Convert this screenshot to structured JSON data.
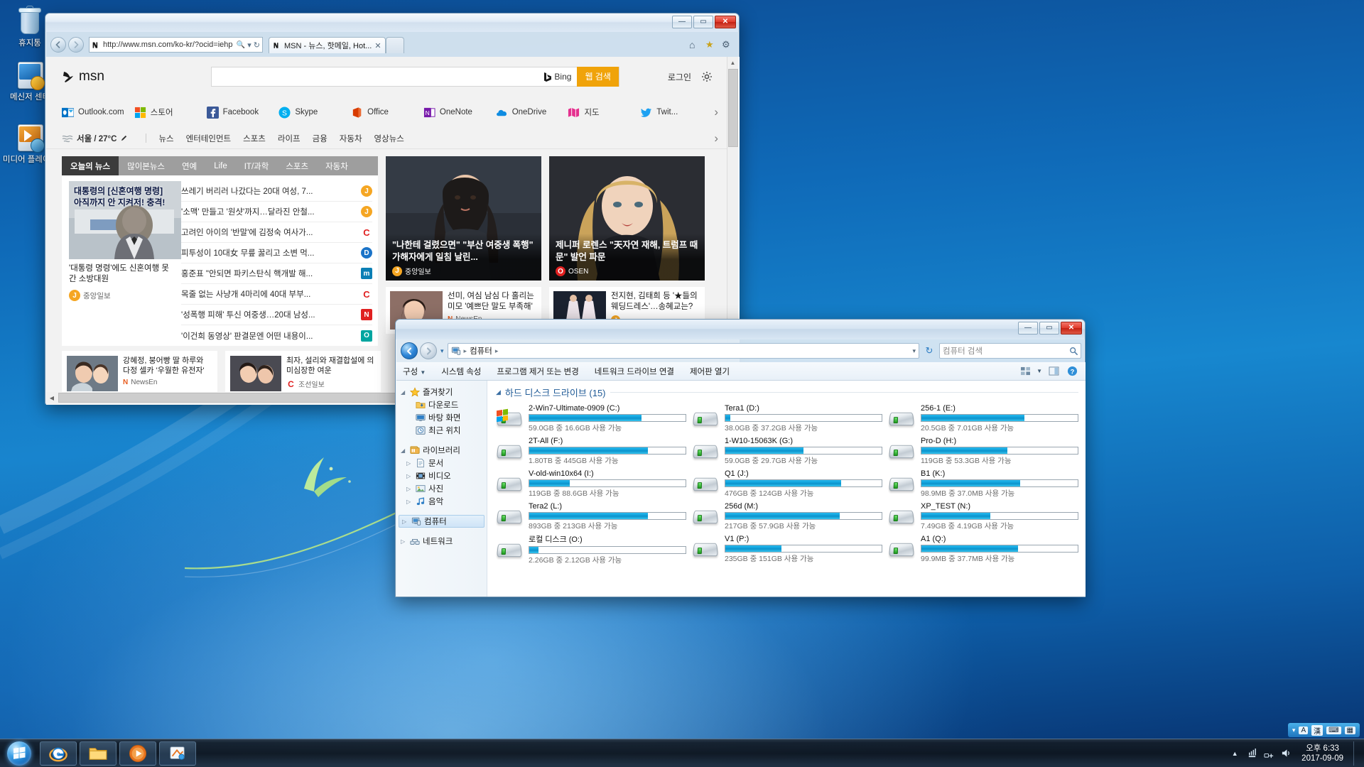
{
  "desktop": {
    "icons": [
      {
        "name": "recycle-bin",
        "label": "휴지통"
      },
      {
        "name": "messenger-center",
        "label": "메신저 센터"
      },
      {
        "name": "media-player",
        "label": "미디어 플레이..."
      }
    ]
  },
  "ie": {
    "window_title": "MSN - 뉴스, 핫메일, Hot...",
    "address": "http://www.msn.com/ko-kr/?ocid=iehp",
    "tabs": [
      {
        "label": "MSN - 뉴스, 핫메일, Hot...",
        "close": "✕"
      }
    ],
    "newtab_label": "",
    "buttons": {
      "back": "◀",
      "forward": "▶",
      "search": "🔍",
      "dropdown": "▾",
      "refresh": "↻",
      "home": "⌂",
      "favorites": "★",
      "tools": "⚙"
    },
    "win_controls": {
      "minimize": "—",
      "maximize": "▭",
      "close": "✕"
    }
  },
  "msn": {
    "logo": "msn",
    "search_placeholder": "",
    "search_value": "",
    "bing_label": "Bing",
    "web_search_label": "웹 검색",
    "signin_label": "로그인",
    "settings_icon": "gear-icon",
    "apps": [
      {
        "label": "Outlook.com",
        "icon": "outlook-icon"
      },
      {
        "label": "스토어",
        "icon": "store-icon"
      },
      {
        "label": "Facebook",
        "icon": "facebook-icon"
      },
      {
        "label": "Skype",
        "icon": "skype-icon"
      },
      {
        "label": "Office",
        "icon": "office-icon"
      },
      {
        "label": "OneNote",
        "icon": "onenote-icon"
      },
      {
        "label": "OneDrive",
        "icon": "onedrive-icon"
      },
      {
        "label": "지도",
        "icon": "maps-icon"
      },
      {
        "label": "Twit...",
        "icon": "twitter-icon"
      }
    ],
    "apps_next": "›",
    "weather": "서울 / 27°C",
    "weather_edit_icon": "pencil-icon",
    "subnav": [
      "뉴스",
      "엔터테인먼트",
      "스포츠",
      "라이프",
      "금융",
      "자동차",
      "영상뉴스"
    ],
    "subnav_next": "›",
    "news_tabs": [
      {
        "label": "오늘의 뉴스",
        "active": true
      },
      {
        "label": "많이본뉴스",
        "active": false
      },
      {
        "label": "연예",
        "active": false
      },
      {
        "label": "Life",
        "active": false
      },
      {
        "label": "IT/과학",
        "active": false
      },
      {
        "label": "스포츠",
        "active": false
      },
      {
        "label": "자동차",
        "active": false
      }
    ],
    "lead": {
      "overlay_line1": "대통령의 [신혼여행 명령]",
      "overlay_line2": "아직까지 안 지켜저! 충격!",
      "title": "'대통령 명령'에도 신혼여행 못 간 소방대원",
      "source": "중앙일보"
    },
    "headlines": [
      {
        "text": "쓰레기 버리러 나갔다는 20대 여성, 7...",
        "chip": "J",
        "chip_color": "#f5a623"
      },
      {
        "text": "'소맥' 만들고 '원샷'까지…달라진 안철...",
        "chip": "J",
        "chip_color": "#f5a623"
      },
      {
        "text": "고려인 아이의 '반말'에 김정숙 여사가...",
        "chip": "C",
        "chip_color": "#e02020"
      },
      {
        "text": "피투성이 10대女 무릎 꿇리고 소변 먹...",
        "chip": "D",
        "chip_color": "#1a73c8"
      },
      {
        "text": "홍준표 \"안되면 파키스탄식 핵개발 해...",
        "chip": "m",
        "chip_color": "#0b7fb5"
      },
      {
        "text": "목줄 없는 사냥개 4마리에 40대 부부...",
        "chip": "C",
        "chip_color": "#e02020"
      },
      {
        "text": "'성폭행 피해' 투신 여중생…20대 남성...",
        "chip": "N",
        "chip_color": "#e02020"
      },
      {
        "text": "'이건희 동영상' 판결문엔 어떤 내용이...",
        "chip": "O",
        "chip_color": "#00a5a0"
      }
    ],
    "featured": [
      {
        "caption": "\"나한테 걸렸으면\" \"부산 여중생 폭행\" 가해자에게 일침 날린...",
        "source": "중앙일보",
        "source_color": "#f5a623"
      },
      {
        "caption": "제니퍼 로렌스 \"天자연 재해, 트럼프 때문\" 발언 파문",
        "source": "OSEN",
        "source_color": "#e02020"
      }
    ],
    "small_cards": [
      {
        "text": "선미, 여심 남심 다 홀리는 미모 '예쁘단 말도 부족해'",
        "source": "NewsEn",
        "source_color": "#e85d1f"
      },
      {
        "text": "전지현, 김태희 등 '★들의 웨딩드레스'…송혜교는?",
        "source": "",
        "source_color": "#f5a623"
      }
    ],
    "bottom_cards": [
      {
        "text": "강혜정, 붕어빵 딸 하루와 다정 셀카 '우월한 유전자'",
        "source": "NewsEn",
        "source_color": "#e85d1f"
      },
      {
        "text": "최자, 설리와 재결합설에 의미심장한 여운",
        "source": "조선일보",
        "source_color": "#e02020"
      }
    ]
  },
  "explorer": {
    "window_title": "",
    "breadcrumb": [
      "컴퓨터"
    ],
    "breadcrumb_root_icon": "computer-icon",
    "search_placeholder": "컴퓨터 검색",
    "search_value": "",
    "buttons": {
      "back": "❮",
      "forward": "❯",
      "history_drop": "▾",
      "refresh": "↻",
      "search": "🔍"
    },
    "win_controls": {
      "minimize": "—",
      "maximize": "▭",
      "close": "✕"
    },
    "toolbar": [
      {
        "label": "구성",
        "has_caret": true
      },
      {
        "label": "시스템 속성",
        "has_caret": false
      },
      {
        "label": "프로그램 제거 또는 변경",
        "has_caret": false
      },
      {
        "label": "네트워크 드라이브 연결",
        "has_caret": false
      },
      {
        "label": "제어판 열기",
        "has_caret": false
      }
    ],
    "toolbar_right": {
      "view_icon": "view-layout-icon",
      "pane_icon": "preview-pane-icon",
      "help_icon": "help-icon"
    },
    "tree": [
      {
        "label": "즐겨찾기",
        "icon": "star-icon",
        "level": 0,
        "arrow": "◢",
        "selected": false
      },
      {
        "label": "다운로드",
        "icon": "downloads-icon",
        "level": 1,
        "arrow": "",
        "selected": false
      },
      {
        "label": "바탕 화면",
        "icon": "desktop-icon",
        "level": 1,
        "arrow": "",
        "selected": false
      },
      {
        "label": "최근 위치",
        "icon": "recent-icon",
        "level": 1,
        "arrow": "",
        "selected": false
      },
      {
        "label": "라이브러리",
        "icon": "library-icon",
        "level": 0,
        "arrow": "◢",
        "selected": false
      },
      {
        "label": "문서",
        "icon": "documents-icon",
        "level": 1,
        "arrow": "▷",
        "selected": false
      },
      {
        "label": "비디오",
        "icon": "videos-icon",
        "level": 1,
        "arrow": "▷",
        "selected": false
      },
      {
        "label": "사진",
        "icon": "pictures-icon",
        "level": 1,
        "arrow": "▷",
        "selected": false
      },
      {
        "label": "음악",
        "icon": "music-icon",
        "level": 1,
        "arrow": "▷",
        "selected": false
      },
      {
        "label": "컴퓨터",
        "icon": "computer-icon",
        "level": 0,
        "arrow": "▷",
        "selected": true
      },
      {
        "label": "네트워크",
        "icon": "network-icon",
        "level": 0,
        "arrow": "▷",
        "selected": false
      }
    ],
    "group_header": "하드 디스크 드라이브 (15)",
    "drives": [
      {
        "name": "2-Win7-Ultimate-0909 (C:)",
        "free_text": "59.0GB 중 16.6GB 사용 가능",
        "used_pct": 72,
        "system": true,
        "critical": false
      },
      {
        "name": "Tera1 (D:)",
        "free_text": "38.0GB 중 37.2GB 사용 가능",
        "used_pct": 3,
        "system": false,
        "critical": false
      },
      {
        "name": "256-1 (E:)",
        "free_text": "20.5GB 중 7.01GB 사용 가능",
        "used_pct": 66,
        "system": false,
        "critical": false
      },
      {
        "name": "2T-All (F:)",
        "free_text": "1.80TB 중 445GB 사용 가능",
        "used_pct": 76,
        "system": false,
        "critical": false
      },
      {
        "name": "1-W10-15063K (G:)",
        "free_text": "59.0GB 중 29.7GB 사용 가능",
        "used_pct": 50,
        "system": false,
        "critical": false
      },
      {
        "name": "Pro-D (H:)",
        "free_text": "119GB 중 53.3GB 사용 가능",
        "used_pct": 55,
        "system": false,
        "critical": false
      },
      {
        "name": "V-old-win10x64 (I:)",
        "free_text": "119GB 중 88.6GB 사용 가능",
        "used_pct": 26,
        "system": false,
        "critical": false
      },
      {
        "name": "Q1 (J:)",
        "free_text": "476GB 중 124GB 사용 가능",
        "used_pct": 74,
        "system": false,
        "critical": false
      },
      {
        "name": "B1 (K:)",
        "free_text": "98.9MB 중 37.0MB 사용 가능",
        "used_pct": 63,
        "system": false,
        "critical": false
      },
      {
        "name": "Tera2 (L:)",
        "free_text": "893GB 중 213GB 사용 가능",
        "used_pct": 76,
        "system": false,
        "critical": false
      },
      {
        "name": "256d (M:)",
        "free_text": "217GB 중 57.9GB 사용 가능",
        "used_pct": 73,
        "system": false,
        "critical": false
      },
      {
        "name": "XP_TEST (N:)",
        "free_text": "7.49GB 중 4.19GB 사용 가능",
        "used_pct": 44,
        "system": false,
        "critical": false
      },
      {
        "name": "로컬 디스크 (O:)",
        "free_text": "2.26GB 중 2.12GB 사용 가능",
        "used_pct": 6,
        "system": false,
        "critical": false
      },
      {
        "name": "V1 (P:)",
        "free_text": "235GB 중 151GB 사용 가능",
        "used_pct": 36,
        "system": false,
        "critical": false
      },
      {
        "name": "A1 (Q:)",
        "free_text": "99.9MB 중 37.7MB 사용 가능",
        "used_pct": 62,
        "system": false,
        "critical": false
      }
    ]
  },
  "taskbar": {
    "start_label": "",
    "items": [
      {
        "name": "internet-explorer",
        "label": "Internet Explorer"
      },
      {
        "name": "windows-explorer",
        "label": "Windows 탐색기"
      },
      {
        "name": "media-player",
        "label": "Windows Media Player"
      },
      {
        "name": "paint-tool",
        "label": "그림판"
      }
    ],
    "tray": {
      "show_hidden": "▲",
      "network": "network-icon",
      "volume": "volume-icon"
    },
    "clock_time": "오후 6:33",
    "clock_date": "2017-09-09",
    "ime": {
      "toggle": "▾",
      "mode_a": "A",
      "mode_hanja": "漢",
      "extra1": "⌨",
      "extra2": "▦"
    }
  }
}
